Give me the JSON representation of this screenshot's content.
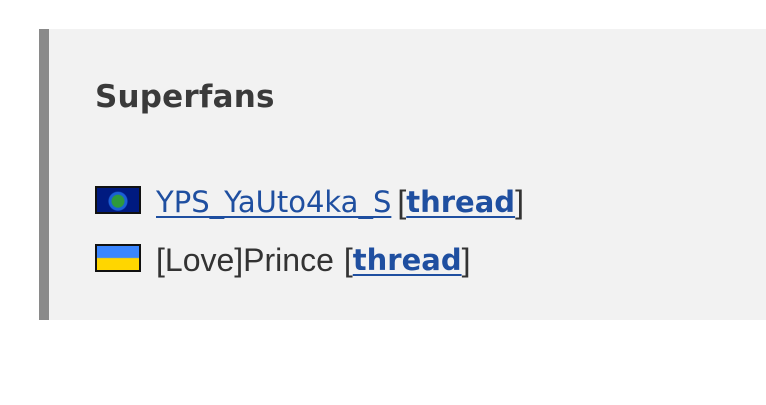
{
  "section": {
    "title": "Superfans"
  },
  "fans": [
    {
      "flag_icon": "globe-flag-icon",
      "name": "YPS_YaUto4ka_S",
      "name_is_link": true,
      "bracket_open": "[",
      "thread_label": "thread",
      "bracket_close": "]"
    },
    {
      "flag_icon": "ukraine-flag-icon",
      "name": "[Love]Prince",
      "name_is_link": false,
      "bracket_open": "[",
      "thread_label": "thread",
      "bracket_close": "]"
    }
  ],
  "colors": {
    "panel_background": "#f2f2f2",
    "panel_border": "#8a8a8a",
    "link": "#1f4fa0",
    "text": "#333333"
  }
}
